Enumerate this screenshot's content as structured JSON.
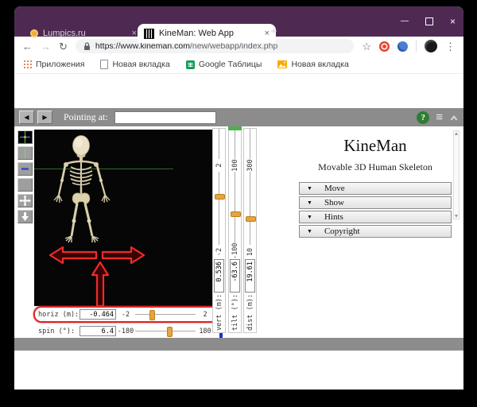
{
  "browser": {
    "tabs": [
      {
        "label": "Lumpics.ru"
      },
      {
        "label": "KineMan: Web App"
      }
    ],
    "url": {
      "host": "https://www.kineman.com",
      "path": "/new/webapp/index.php"
    },
    "bookmarks": [
      {
        "label": "Приложения"
      },
      {
        "label": "Новая вкладка"
      },
      {
        "label": "Google Таблицы"
      },
      {
        "label": "Новая вкладка"
      }
    ]
  },
  "icons": {
    "tab_close": "×",
    "new_tab": "+",
    "minimize": "—",
    "close_window": "×",
    "back": "←",
    "forward": "→",
    "reload": "↻",
    "star": "☆",
    "menu_dots": "⋮",
    "prev": "◀",
    "next": "▶",
    "help": "?",
    "menu_bars": "≡",
    "accordion_arrow": "▼"
  },
  "app": {
    "toolbar": {
      "pointing_at_label": "Pointing at:",
      "pointing_at_value": ""
    },
    "panel": {
      "title": "KineMan",
      "subtitle": "Movable 3D Human Skeleton",
      "menu": [
        {
          "label": "Move"
        },
        {
          "label": "Show"
        },
        {
          "label": "Hints"
        },
        {
          "label": "Copyright"
        }
      ]
    },
    "sliders": {
      "vert": {
        "label": "vert (m):",
        "value": "0.536",
        "min": "-2",
        "max": "2"
      },
      "tilt": {
        "label": "tilt (°):",
        "value": "-63.6",
        "min": "-100",
        "max": "100"
      },
      "dist": {
        "label": "dist (m):",
        "value": "19.61",
        "min": "10",
        "max": "300"
      },
      "horiz": {
        "label": "horiz (m):",
        "value": "-0.464",
        "min": "-2",
        "max": "2"
      },
      "spin": {
        "label": "spin (°):",
        "value": "6.4",
        "min": "-180",
        "max": "180"
      }
    },
    "colors": {
      "titlebar_purple": "#4e2a52",
      "toolbar_gray": "#8c8c8c",
      "thumb_orange": "#e8a33d",
      "annotation_red": "#dc2626",
      "help_green": "#2e7d32"
    }
  }
}
